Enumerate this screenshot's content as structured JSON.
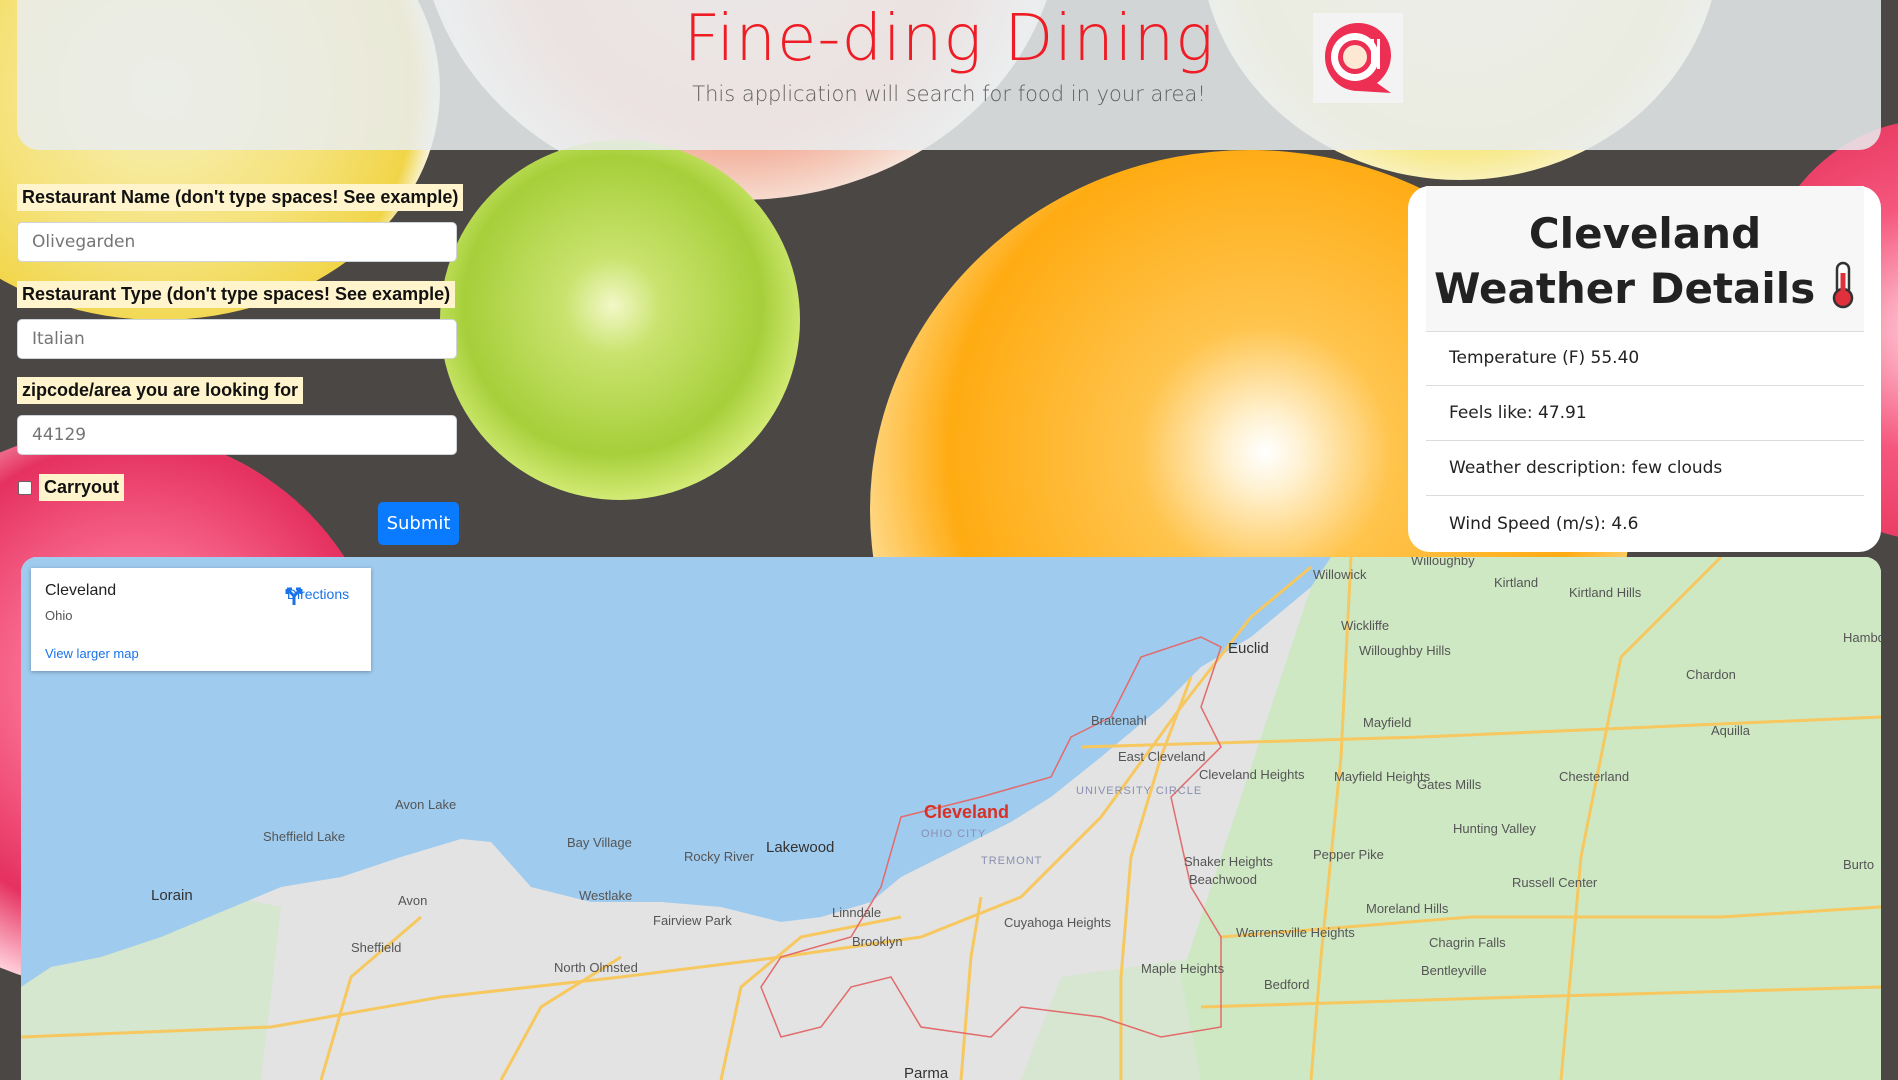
{
  "header": {
    "title": "Fine-ding Dining",
    "subtitle": "This application will search for food in your area!"
  },
  "form": {
    "name_label": "Restaurant Name (don't type spaces! See example)",
    "name_placeholder": "Olivegarden",
    "type_label": "Restaurant Type (don't type spaces! See example)",
    "type_placeholder": "Italian",
    "zip_label": "zipcode/area you are looking for",
    "zip_placeholder": "44129",
    "carryout_label": "Carryout",
    "carryout_checked": false,
    "submit_label": "Submit"
  },
  "weather": {
    "title": "Cleveland Weather Details",
    "icon": "thermometer-icon",
    "rows": [
      "Temperature (F) 55.40",
      "Feels like: 47.91",
      "Weather description: few clouds",
      "Wind Speed (m/s): 4.6"
    ]
  },
  "map": {
    "card_title": "Cleveland",
    "card_subtitle": "Ohio",
    "directions_label": "Directions",
    "larger_map_label": "View larger map",
    "places": {
      "cleveland": "Cleveland",
      "lakewood": "Lakewood",
      "euclid": "Euclid",
      "parma": "Parma",
      "lorain": "Lorain",
      "willowick": "Willowick",
      "willoughby": "Willoughby",
      "kirtland": "Kirtland",
      "kirtland_hills": "Kirtland Hills",
      "wickliffe": "Wickliffe",
      "willoughby_hills": "Willoughby Hills",
      "chardon": "Chardon",
      "mayfield": "Mayfield",
      "aquilla": "Aquilla",
      "bratenahl": "Bratenahl",
      "east_cleveland": "East Cleveland",
      "cleveland_heights": "Cleveland Heights",
      "mayfield_heights": "Mayfield Heights",
      "gates_mills": "Gates Mills",
      "chesterland": "Chesterland",
      "university_circle": "UNIVERSITY CIRCLE",
      "ohio_city": "OHIO CITY",
      "tremont": "TREMONT",
      "avon_lake": "Avon Lake",
      "sheffield_lake": "Sheffield Lake",
      "bay_village": "Bay Village",
      "rocky_river": "Rocky River",
      "westlake": "Westlake",
      "avon": "Avon",
      "sheffield": "Sheffield",
      "fairview_park": "Fairview Park",
      "linndale": "Linndale",
      "brooklyn": "Brooklyn",
      "cuyahoga_heights": "Cuyahoga Heights",
      "north_olmsted": "North Olmsted",
      "shaker_heights": "Shaker Heights",
      "beachwood": "Beachwood",
      "pepper_pike": "Pepper Pike",
      "hunting_valley": "Hunting Valley",
      "russell_center": "Russell Center",
      "moreland_hills": "Moreland Hills",
      "warrensville_heights": "Warrensville Heights",
      "chagrin_falls": "Chagrin Falls",
      "bentleyville": "Bentleyville",
      "maple_heights": "Maple Heights",
      "bedford": "Bedford",
      "hambden": "Hambd",
      "burton": "Burto"
    }
  },
  "colors": {
    "title_red": "#ee1c25",
    "submit_blue": "#0a7bff",
    "lake_blue": "#9fcbef",
    "land_green": "#cfe8c4",
    "urban_gray": "#e3e3e3"
  }
}
